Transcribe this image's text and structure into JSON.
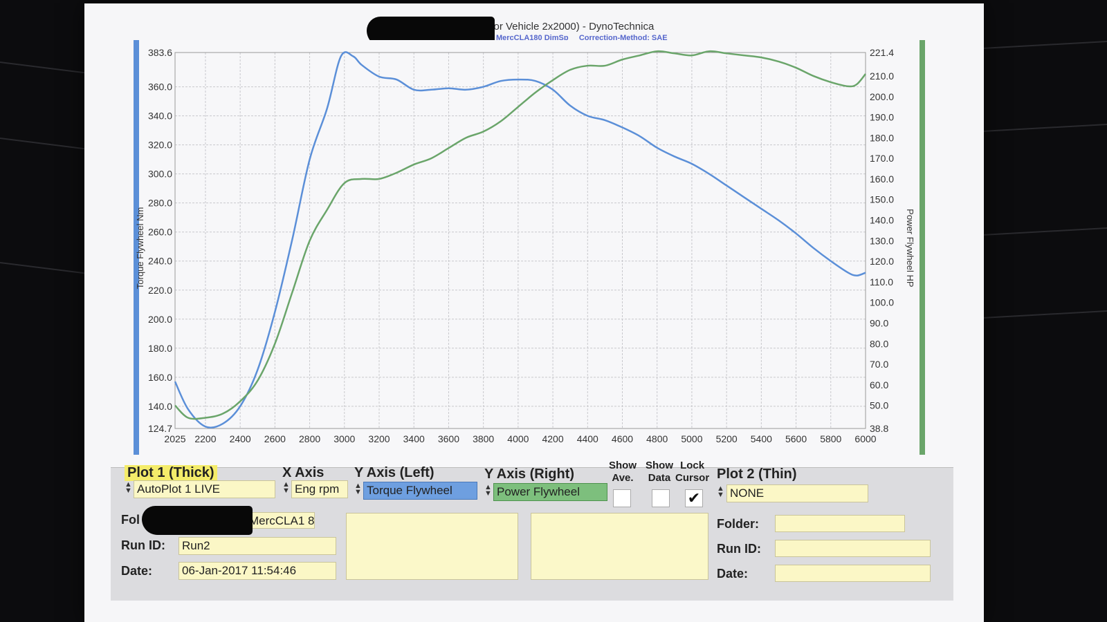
{
  "header": {
    "title": "RHA█████████D - Motor Vehicle 2x2000) - DynoTechnica",
    "subtitle_left": "MercCLA180 DimSp",
    "subtitle_right": "Correction-Method: SAE"
  },
  "colors": {
    "torque": "#5b8fd8",
    "power": "#6aa56a",
    "yellow_field": "#fbf7c6",
    "blue_field": "#6e9fe0",
    "green_field": "#7dbf7d"
  },
  "chart_data": {
    "type": "line",
    "xlabel": "",
    "ylabel_left": "Torque Flywheel Nm",
    "ylabel_right": "Power Flywheel HP",
    "xlim": [
      2025,
      6000
    ],
    "ylim_left": [
      124.7,
      383.6
    ],
    "ylim_right": [
      38.8,
      221.4
    ],
    "x_ticks": [
      2025,
      2200,
      2400,
      2600,
      2800,
      3000,
      3200,
      3400,
      3600,
      3800,
      4000,
      4200,
      4400,
      4600,
      4800,
      5000,
      5200,
      5400,
      5600,
      5800,
      6000
    ],
    "y_left_ticks": [
      "383.6",
      "360.0",
      "340.0",
      "320.0",
      "300.0",
      "280.0",
      "260.0",
      "240.0",
      "220.0",
      "200.0",
      "180.0",
      "160.0",
      "140.0",
      "124.7"
    ],
    "y_right_ticks": [
      "221.4",
      "210.0",
      "200.0",
      "190.0",
      "180.0",
      "170.0",
      "160.0",
      "150.0",
      "140.0",
      "130.0",
      "120.0",
      "110.0",
      "100.0",
      "90.0",
      "80.0",
      "70.0",
      "60.0",
      "50.0",
      "38.8"
    ],
    "grid": true,
    "series": [
      {
        "name": "Torque Flywheel",
        "axis": "left",
        "x": [
          2025,
          2100,
          2200,
          2300,
          2400,
          2500,
          2600,
          2700,
          2800,
          2900,
          2980,
          3050,
          3100,
          3200,
          3300,
          3400,
          3500,
          3600,
          3700,
          3800,
          3900,
          4000,
          4100,
          4200,
          4300,
          4400,
          4500,
          4600,
          4700,
          4800,
          4900,
          5000,
          5100,
          5200,
          5300,
          5400,
          5500,
          5600,
          5700,
          5800,
          5900,
          5950,
          6000
        ],
        "y": [
          157,
          138,
          126,
          128,
          140,
          165,
          205,
          255,
          310,
          345,
          381,
          381,
          375,
          367,
          365,
          358,
          358,
          359,
          358,
          360,
          364,
          365,
          364,
          358,
          347,
          340,
          337,
          332,
          326,
          318,
          312,
          307,
          300,
          292,
          284,
          276,
          268,
          259,
          249,
          240,
          232,
          230,
          232
        ]
      },
      {
        "name": "Power Flywheel",
        "axis": "right",
        "x": [
          2025,
          2100,
          2200,
          2300,
          2400,
          2500,
          2600,
          2700,
          2800,
          2900,
          3000,
          3100,
          3200,
          3300,
          3400,
          3500,
          3600,
          3700,
          3800,
          3900,
          4000,
          4100,
          4200,
          4300,
          4400,
          4500,
          4600,
          4700,
          4800,
          4900,
          5000,
          5100,
          5200,
          5300,
          5400,
          5500,
          5600,
          5700,
          5800,
          5900,
          5950,
          6000
        ],
        "y": [
          50,
          44,
          44,
          46,
          52,
          62,
          80,
          105,
          130,
          145,
          158,
          160,
          160,
          163,
          167,
          170,
          175,
          180,
          183,
          188,
          195,
          202,
          208,
          213,
          215,
          215,
          218,
          220,
          222,
          221,
          220,
          222,
          221,
          220,
          219,
          217,
          214,
          210,
          207,
          205,
          206,
          211
        ]
      }
    ]
  },
  "panel": {
    "plot1_label": "Plot 1 (Thick)",
    "plot1_value": "AutoPlot 1 LIVE",
    "xaxis_label": "X Axis",
    "xaxis_value": "Eng rpm",
    "yleft_label": "Y Axis (Left)",
    "yleft_value": "Torque Flywheel",
    "yright_label": "Y Axis (Right)",
    "yright_value": "Power Flywheel",
    "show_ave_line1": "Show",
    "show_ave_line2": "Ave.",
    "show_data_line1": "Show",
    "show_data_line2": "Data",
    "lock_cursor_line1": "Lock",
    "lock_cursor_line2": "Cursor",
    "plot2_label": "Plot 2 (Thin)",
    "plot2_value": "NONE",
    "folder_label": "Fol",
    "folder_value": "MercCLA1 8",
    "runid_label": "Run ID:",
    "runid_value": "Run2",
    "date_label": "Date:",
    "date_value": "06-Jan-2017  11:54:46",
    "folder2_label": "Folder:",
    "runid2_label": "Run ID:",
    "date2_label": "Date:"
  }
}
